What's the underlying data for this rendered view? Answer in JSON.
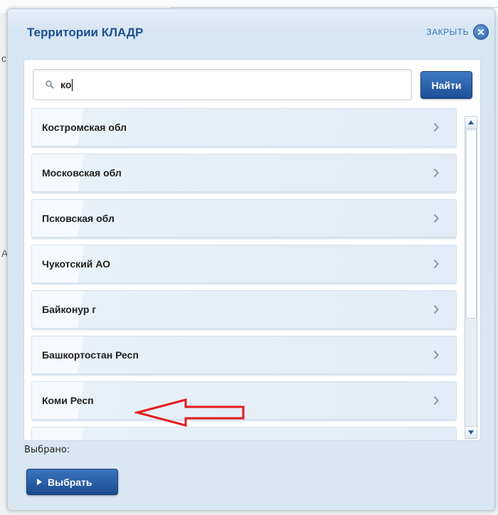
{
  "dialog": {
    "title": "Территории КЛАДР",
    "close_label": "ЗАКРЫТЬ",
    "close_icon": "close-circle-icon"
  },
  "search": {
    "value": "ко",
    "button_label": "Найти",
    "icon": "search-icon"
  },
  "results": {
    "items": [
      {
        "label": "Костромская обл"
      },
      {
        "label": "Московская обл"
      },
      {
        "label": "Псковская обл"
      },
      {
        "label": "Чукотский АО"
      },
      {
        "label": "Байконур г"
      },
      {
        "label": "Башкортостан Респ"
      },
      {
        "label": "Коми Респ"
      },
      {
        "label": ""
      }
    ],
    "item_icon": "chevron-right-icon"
  },
  "footer": {
    "selected_label": "Выбрано:",
    "choose_button_label": "Выбрать"
  },
  "colors": {
    "accent": "#1d4f96",
    "title": "#1c4f92",
    "annotation": "#e31b1b"
  }
}
